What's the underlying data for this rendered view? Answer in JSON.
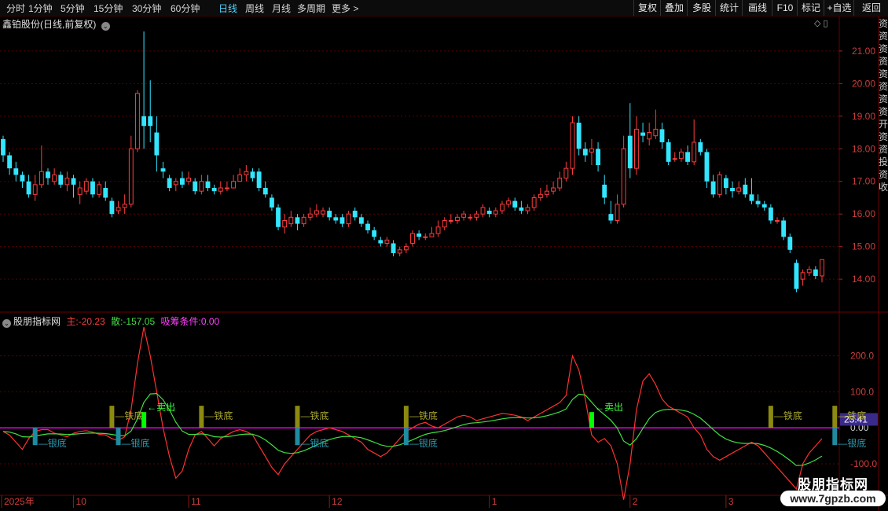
{
  "toolbar": {
    "periods": [
      "分时",
      "1分钟",
      "5分钟",
      "15分钟",
      "30分钟",
      "60分钟",
      "日线",
      "周线",
      "月线",
      "多周期",
      "更多"
    ],
    "more_arrow": ">",
    "active": "日线",
    "right_buttons": [
      "复权",
      "叠加",
      "多股",
      "统计",
      "画线",
      "F10",
      "标记",
      "+自选",
      "返回"
    ]
  },
  "price_panel": {
    "title": "鑫铂股份(日线,前复权)",
    "y_ticks": [
      "21.00",
      "20.00",
      "19.00",
      "18.00",
      "17.00",
      "16.00",
      "15.00",
      "14.00"
    ],
    "corner_icons": "◇ ▯"
  },
  "indicator_panel": {
    "name": "股朋指标网",
    "main_label": "主:",
    "main_value": "-20.23",
    "san_label": "散:",
    "san_value": "-157.05",
    "cond_label": "吸筹条件:",
    "cond_value": "0.00",
    "y_ticks": [
      "200.0",
      "100.0",
      "0.00",
      "-100.0"
    ],
    "current_value_badge": "23.41",
    "labels": {
      "tie_di": "铁底",
      "yin_di": "银底",
      "sell": "←卖出"
    }
  },
  "x_axis": {
    "labels": [
      "2025年",
      "10",
      "11",
      "12",
      "1",
      "2",
      "3"
    ]
  },
  "right_strip_text": "资资资资资资资资开资资投资收",
  "watermark": {
    "name": "股朋指标网",
    "url": "www.7gpzb.com"
  },
  "colors": {
    "up": "#ff3c3c",
    "down": "#32e6ff",
    "main_line": "#ff3030",
    "san_line": "#40e040",
    "zero_line": "#ff00ff",
    "tie_bar": "#8c8a10",
    "yin_bar": "#1e8ca0",
    "sell_bar": "#00ff00",
    "grid": "#5a0000"
  },
  "chart_data": {
    "type": "candlestick",
    "price_range": [
      13.4,
      21.6
    ],
    "indicator_range": [
      -170,
      280
    ],
    "candles": [
      [
        18.3,
        17.8,
        18.4,
        17.6
      ],
      [
        17.8,
        17.4,
        17.9,
        17.2
      ],
      [
        17.4,
        17.2,
        17.6,
        17.0
      ],
      [
        17.2,
        17.0,
        17.3,
        16.8
      ],
      [
        17.0,
        16.6,
        17.2,
        16.5
      ],
      [
        16.6,
        16.9,
        17.2,
        16.4
      ],
      [
        16.9,
        17.3,
        18.1,
        16.8
      ],
      [
        17.3,
        17.1,
        17.4,
        16.9
      ],
      [
        17.0,
        17.2,
        17.4,
        16.9
      ],
      [
        17.2,
        16.9,
        17.3,
        16.8
      ],
      [
        16.9,
        17.1,
        17.3,
        16.7
      ],
      [
        17.1,
        16.9,
        17.2,
        16.5
      ],
      [
        16.6,
        16.8,
        17.0,
        16.3
      ],
      [
        16.7,
        17.0,
        17.1,
        16.6
      ],
      [
        17.0,
        16.6,
        17.1,
        16.5
      ],
      [
        16.6,
        16.9,
        17.0,
        16.5
      ],
      [
        16.8,
        16.5,
        17.0,
        16.4
      ],
      [
        16.4,
        16.0,
        16.5,
        15.9
      ],
      [
        16.1,
        16.2,
        16.4,
        16.0
      ],
      [
        16.2,
        16.3,
        16.6,
        16.0
      ],
      [
        16.3,
        18.0,
        18.4,
        16.2
      ],
      [
        18.0,
        19.7,
        19.8,
        17.9
      ],
      [
        19.0,
        18.7,
        21.6,
        18.0
      ],
      [
        19.0,
        18.7,
        20.1,
        18.2
      ],
      [
        18.5,
        17.8,
        19.0,
        17.3
      ],
      [
        17.4,
        17.3,
        17.6,
        17.1
      ],
      [
        17.1,
        16.8,
        17.2,
        16.7
      ],
      [
        16.9,
        17.0,
        17.1,
        16.7
      ],
      [
        17.1,
        16.9,
        17.3,
        16.8
      ],
      [
        17.0,
        17.1,
        17.3,
        16.9
      ],
      [
        17.0,
        16.7,
        17.1,
        16.6
      ],
      [
        16.7,
        17.0,
        17.2,
        16.6
      ],
      [
        17.0,
        16.8,
        17.2,
        16.7
      ],
      [
        16.8,
        16.7,
        16.9,
        16.6
      ],
      [
        16.7,
        16.8,
        17.0,
        16.6
      ],
      [
        16.8,
        16.8,
        17.0,
        16.7
      ],
      [
        16.8,
        17.0,
        17.2,
        16.8
      ],
      [
        17.0,
        17.2,
        17.4,
        17.0
      ],
      [
        17.2,
        17.3,
        17.5,
        17.0
      ],
      [
        17.3,
        17.1,
        17.4,
        17.0
      ],
      [
        17.3,
        16.8,
        17.4,
        16.7
      ],
      [
        16.8,
        16.6,
        17.0,
        16.5
      ],
      [
        16.5,
        16.2,
        16.6,
        16.1
      ],
      [
        16.2,
        15.6,
        16.3,
        15.5
      ],
      [
        15.6,
        15.8,
        16.0,
        15.4
      ],
      [
        15.7,
        15.9,
        16.1,
        15.6
      ],
      [
        15.9,
        15.7,
        16.0,
        15.5
      ],
      [
        15.7,
        15.9,
        16.0,
        15.6
      ],
      [
        15.9,
        16.0,
        16.2,
        15.8
      ],
      [
        16.0,
        16.1,
        16.3,
        15.9
      ],
      [
        16.0,
        16.1,
        16.2,
        15.9
      ],
      [
        16.1,
        15.9,
        16.2,
        15.8
      ],
      [
        15.9,
        15.8,
        16.0,
        15.7
      ],
      [
        15.9,
        15.7,
        16.0,
        15.6
      ],
      [
        15.7,
        16.0,
        16.1,
        15.6
      ],
      [
        16.1,
        15.9,
        16.2,
        15.8
      ],
      [
        15.9,
        15.7,
        16.0,
        15.6
      ],
      [
        15.7,
        15.5,
        15.8,
        15.4
      ],
      [
        15.5,
        15.3,
        15.6,
        15.2
      ],
      [
        15.2,
        15.1,
        15.3,
        15.0
      ],
      [
        15.1,
        15.2,
        15.3,
        15.0
      ],
      [
        15.1,
        14.8,
        15.2,
        14.7
      ],
      [
        14.8,
        14.9,
        15.0,
        14.7
      ],
      [
        14.9,
        15.0,
        15.1,
        14.8
      ],
      [
        15.1,
        15.4,
        15.5,
        15.0
      ],
      [
        15.4,
        15.3,
        15.5,
        15.2
      ],
      [
        15.3,
        15.3,
        15.4,
        15.2
      ],
      [
        15.3,
        15.4,
        15.6,
        15.3
      ],
      [
        15.4,
        15.6,
        15.8,
        15.3
      ],
      [
        15.6,
        15.8,
        15.9,
        15.5
      ],
      [
        15.8,
        15.8,
        16.0,
        15.7
      ],
      [
        15.8,
        15.9,
        16.0,
        15.7
      ],
      [
        15.9,
        16.0,
        16.1,
        15.8
      ],
      [
        15.9,
        15.9,
        16.0,
        15.8
      ],
      [
        15.9,
        16.0,
        16.1,
        15.8
      ],
      [
        16.0,
        16.2,
        16.3,
        15.9
      ],
      [
        16.1,
        16.0,
        16.2,
        15.9
      ],
      [
        16.0,
        16.1,
        16.2,
        15.9
      ],
      [
        16.1,
        16.3,
        16.4,
        16.0
      ],
      [
        16.3,
        16.4,
        16.5,
        16.2
      ],
      [
        16.4,
        16.2,
        16.5,
        16.1
      ],
      [
        16.2,
        16.1,
        16.4,
        16.0
      ],
      [
        16.1,
        16.2,
        16.3,
        16.0
      ],
      [
        16.2,
        16.5,
        16.6,
        16.1
      ],
      [
        16.5,
        16.6,
        16.8,
        16.4
      ],
      [
        16.6,
        16.7,
        16.9,
        16.5
      ],
      [
        16.7,
        16.8,
        17.0,
        16.6
      ],
      [
        16.8,
        17.1,
        17.3,
        16.7
      ],
      [
        17.1,
        17.4,
        17.6,
        17.0
      ],
      [
        17.4,
        18.8,
        19.0,
        17.2
      ],
      [
        18.8,
        18.0,
        19.0,
        17.8
      ],
      [
        18.0,
        17.8,
        18.2,
        17.6
      ],
      [
        17.9,
        18.0,
        18.3,
        17.5
      ],
      [
        18.0,
        17.5,
        18.2,
        17.3
      ],
      [
        16.9,
        16.5,
        17.2,
        16.3
      ],
      [
        16.0,
        15.8,
        16.4,
        15.7
      ],
      [
        15.8,
        16.3,
        16.6,
        15.7
      ],
      [
        16.3,
        18.0,
        18.4,
        16.2
      ],
      [
        18.4,
        17.4,
        19.4,
        17.1
      ],
      [
        17.4,
        18.6,
        19.0,
        17.2
      ],
      [
        18.5,
        18.4,
        18.8,
        18.2
      ],
      [
        18.3,
        18.5,
        18.8,
        18.1
      ],
      [
        18.4,
        18.6,
        19.2,
        18.3
      ],
      [
        18.6,
        18.2,
        18.8,
        18.0
      ],
      [
        18.2,
        17.6,
        18.3,
        17.5
      ],
      [
        17.7,
        17.7,
        17.9,
        17.6
      ],
      [
        17.7,
        17.9,
        18.0,
        17.6
      ],
      [
        17.9,
        17.6,
        18.1,
        17.5
      ],
      [
        17.6,
        18.2,
        18.9,
        17.5
      ],
      [
        18.2,
        17.9,
        18.3,
        17.8
      ],
      [
        17.9,
        17.0,
        18.0,
        16.8
      ],
      [
        17.0,
        16.6,
        17.2,
        16.5
      ],
      [
        16.6,
        17.2,
        17.3,
        16.5
      ],
      [
        17.1,
        16.8,
        17.2,
        16.6
      ],
      [
        16.8,
        16.7,
        17.0,
        16.5
      ],
      [
        16.7,
        16.8,
        17.0,
        16.6
      ],
      [
        16.9,
        16.6,
        17.1,
        16.5
      ],
      [
        16.6,
        16.4,
        17.1,
        16.3
      ],
      [
        16.4,
        16.3,
        16.6,
        16.2
      ],
      [
        16.3,
        16.2,
        16.4,
        16.1
      ],
      [
        16.2,
        15.8,
        16.3,
        15.7
      ],
      [
        15.8,
        15.8,
        15.9,
        15.7
      ],
      [
        15.8,
        15.3,
        15.9,
        15.2
      ],
      [
        15.3,
        14.9,
        15.4,
        14.8
      ],
      [
        14.5,
        13.7,
        14.6,
        13.6
      ],
      [
        14.0,
        14.2,
        14.3,
        13.8
      ],
      [
        14.2,
        14.3,
        14.4,
        14.1
      ],
      [
        14.3,
        14.1,
        14.4,
        14.0
      ],
      [
        14.1,
        14.6,
        14.6,
        13.9
      ]
    ],
    "main_series": [
      -10,
      -20,
      -40,
      -60,
      -30,
      -10,
      -5,
      -5,
      -15,
      -20,
      -25,
      -15,
      -10,
      -8,
      -12,
      -18,
      -20,
      -30,
      -35,
      -25,
      50,
      180,
      280,
      200,
      100,
      0,
      -80,
      -140,
      -120,
      -60,
      -20,
      -10,
      -30,
      -50,
      -30,
      -20,
      -10,
      -5,
      -10,
      -20,
      -50,
      -80,
      -110,
      -130,
      -100,
      -80,
      -60,
      -40,
      -20,
      -10,
      -5,
      0,
      -5,
      -10,
      -20,
      -30,
      -40,
      -60,
      -70,
      -80,
      -70,
      -50,
      -30,
      -10,
      0,
      10,
      15,
      5,
      0,
      10,
      20,
      30,
      35,
      30,
      20,
      25,
      30,
      35,
      40,
      38,
      35,
      30,
      20,
      30,
      40,
      50,
      60,
      70,
      90,
      200,
      160,
      80,
      -20,
      -40,
      -30,
      -50,
      -100,
      -200,
      -100,
      50,
      130,
      150,
      120,
      80,
      60,
      50,
      40,
      30,
      0,
      -20,
      -60,
      -80,
      -90,
      -80,
      -70,
      -60,
      -50,
      -40,
      -50,
      -70,
      -90,
      -110,
      -130,
      -150,
      -170,
      -100,
      -70,
      -50,
      -30
    ]
  }
}
